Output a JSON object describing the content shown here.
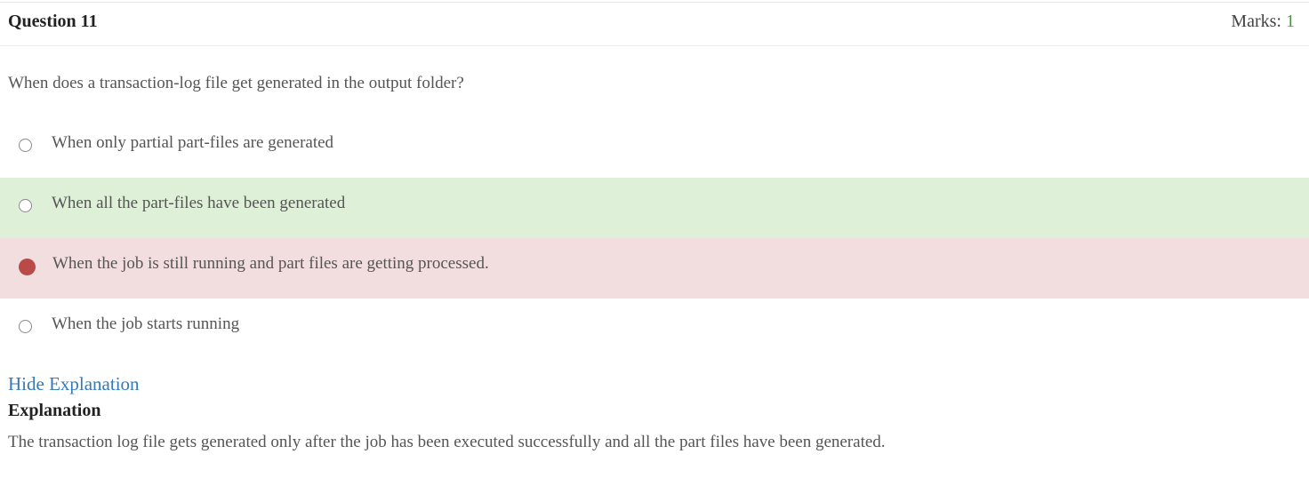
{
  "question": {
    "title": "Question 11",
    "marks_label": "Marks:",
    "marks_value": "1",
    "text": "When does a transaction-log file get generated in the output folder?"
  },
  "options": [
    {
      "label": "When only partial part-files are generated",
      "state": "none"
    },
    {
      "label": "When all the part-files have been generated",
      "state": "correct"
    },
    {
      "label": "When the job is still running and part files are getting processed.",
      "state": "wrong-selected"
    },
    {
      "label": "When the job starts running",
      "state": "none"
    }
  ],
  "explanation": {
    "toggle_label": "Hide Explanation",
    "title": "Explanation",
    "text": "The transaction log file gets generated only after the job has been executed successfully and all the part files have been generated."
  },
  "colors": {
    "correct_bg": "#dff0d8",
    "wrong_bg": "#f2dede",
    "selected_radio": "#b94a48",
    "link": "#337ab7",
    "marks_value": "#3c9a3c"
  }
}
